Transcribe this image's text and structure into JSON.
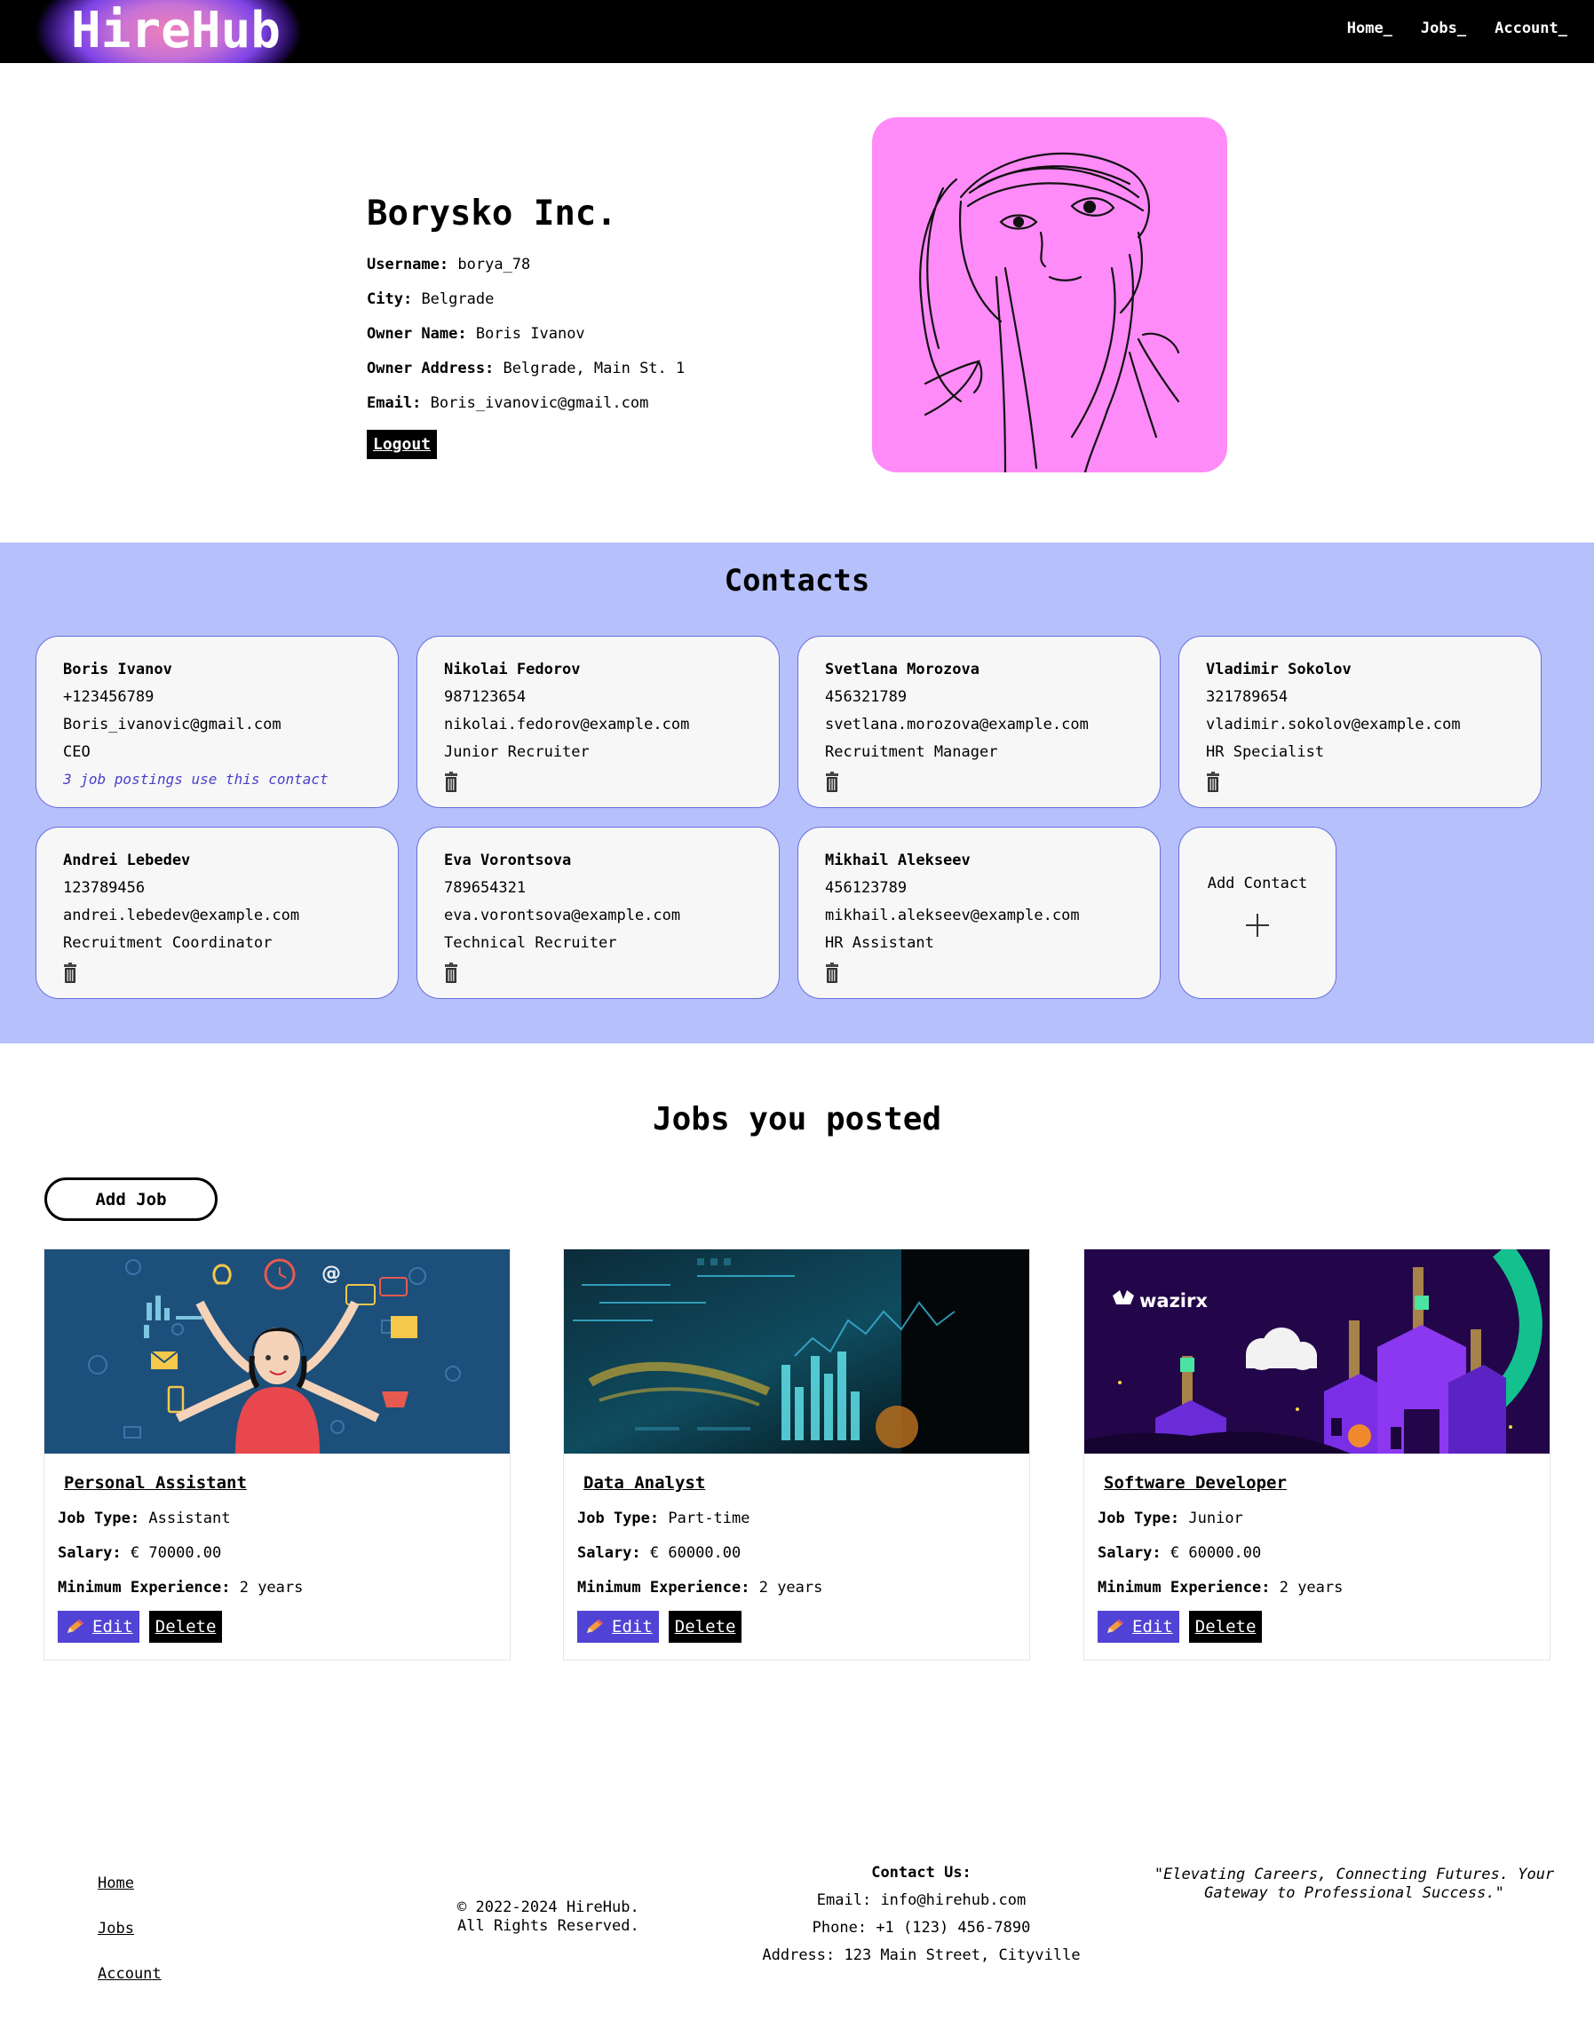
{
  "nav": {
    "logo": "HireHub",
    "links": [
      "Home_",
      "Jobs_",
      "Account_"
    ]
  },
  "profile": {
    "company": "Borysko Inc.",
    "fields": [
      {
        "label": "Username:",
        "value": "borya_78"
      },
      {
        "label": "City:",
        "value": "Belgrade"
      },
      {
        "label": "Owner Name:",
        "value": "Boris Ivanov"
      },
      {
        "label": "Owner Address:",
        "value": "Belgrade, Main St. 1"
      },
      {
        "label": "Email:",
        "value": "Boris_ivanovic@gmail.com"
      }
    ],
    "logout_label": "Logout"
  },
  "contacts": {
    "title": "Contacts",
    "items": [
      {
        "name": "Boris Ivanov",
        "phone": "+123456789",
        "email": "Boris_ivanovic@gmail.com",
        "role": "CEO",
        "note": "3 job postings use this contact"
      },
      {
        "name": "Nikolai Fedorov",
        "phone": "987123654",
        "email": "nikolai.fedorov@example.com",
        "role": "Junior Recruiter"
      },
      {
        "name": "Svetlana Morozova",
        "phone": "456321789",
        "email": "svetlana.morozova@example.com",
        "role": "Recruitment Manager"
      },
      {
        "name": "Vladimir Sokolov",
        "phone": "321789654",
        "email": "vladimir.sokolov@example.com",
        "role": "HR Specialist"
      },
      {
        "name": "Andrei Lebedev",
        "phone": "123789456",
        "email": "andrei.lebedev@example.com",
        "role": "Recruitment Coordinator"
      },
      {
        "name": "Eva Vorontsova",
        "phone": "789654321",
        "email": "eva.vorontsova@example.com",
        "role": "Technical Recruiter"
      },
      {
        "name": "Mikhail Alekseev",
        "phone": "456123789",
        "email": "mikhail.alekseev@example.com",
        "role": "HR Assistant"
      }
    ],
    "add_label": "Add Contact"
  },
  "jobs": {
    "title": "Jobs you posted",
    "add_label": "Add Job",
    "items": [
      {
        "title": "Personal Assistant",
        "type_label": "Job Type:",
        "type": "Assistant",
        "salary_label": "Salary:",
        "salary": "€ 70000.00",
        "exp_label": "Minimum Experience:",
        "exp": "2 years"
      },
      {
        "title": "Data Analyst",
        "type_label": "Job Type:",
        "type": "Part-time",
        "salary_label": "Salary:",
        "salary": "€ 60000.00",
        "exp_label": "Minimum Experience:",
        "exp": "2 years"
      },
      {
        "title": "Software Developer",
        "type_label": "Job Type:",
        "type": "Junior",
        "salary_label": "Salary:",
        "salary": "€ 60000.00",
        "exp_label": "Minimum Experience:",
        "exp": "2 years"
      }
    ],
    "edit_label": "Edit",
    "delete_label": "Delete",
    "brand_in_image": "wazirx"
  },
  "footer": {
    "links": [
      "Home",
      "Jobs",
      "Account"
    ],
    "copyright": "© 2022-2024 HireHub.\nAll Rights Reserved.",
    "contact_heading": "Contact Us:",
    "contact_email": "Email: info@hirehub.com",
    "contact_phone": "Phone: +1 (123) 456-7890",
    "contact_address": "Address: 123 Main Street, Cityville",
    "tagline": "\"Elevating Careers, Connecting Futures. Your Gateway to Professional Success.\""
  },
  "colors": {
    "nav_bg": "#000000",
    "contacts_bg": "#b6c0fb",
    "avatar_bg": "#ff8bf9",
    "edit_button": "#5143d5",
    "contact_note": "#4b3fc8"
  },
  "icons": [
    "trash-icon",
    "plus-icon",
    "pencil-icon"
  ]
}
